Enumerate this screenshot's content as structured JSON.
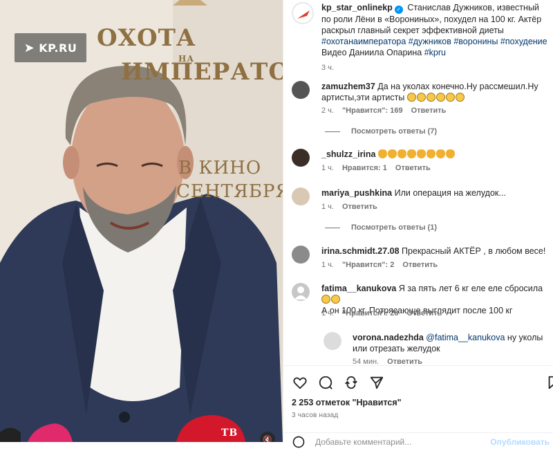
{
  "media": {
    "watermark": "KP.RU",
    "poster_title_line1": "ОХОТА",
    "poster_title_small": "НА",
    "poster_title_line2": "ИМПЕРАТОРА",
    "poster_sub1": "В КИНО",
    "poster_sub2": "СЕНТЯБРЯ",
    "mic_brand": "ТВ"
  },
  "post": {
    "username": "kp_star_onlinekp",
    "caption_text": "Станислав Дужников, известный по роли Лёни в «Ворониных», похудел на 100 кг. Актёр раскрыл главный секрет эффективной диеты",
    "tags1": "#охотанаимператора",
    "tags2": "#дужников #воронины #похудение",
    "video_credit": "Видео Даниила Опарина",
    "tag_kpru": "#kpru",
    "time": "3 ч."
  },
  "comments": [
    {
      "username": "zamuzhem37",
      "text": "Да на уколах конечно.Ну рассмешил.Ну артисты,эти артисты",
      "time": "2 ч.",
      "likes": "\"Нравится\": 169",
      "reply": "Ответить",
      "view_replies": "Посмотреть ответы (7)"
    },
    {
      "username": "_shulzz_irina",
      "text": "",
      "time": "1 ч.",
      "likes": "Нравится: 1",
      "reply": "Ответить"
    },
    {
      "username": "mariya_pushkina",
      "text": "Или операция на желудок...",
      "time": "1 ч.",
      "reply": "Ответить",
      "view_replies": "Посмотреть ответы (1)"
    },
    {
      "username": "irina.schmidt.27.08",
      "text": "Прекрасный АКТЁР , в любом весе!",
      "time": "1 ч.",
      "likes": "\"Нравится\": 2",
      "reply": "Ответить"
    },
    {
      "username": "fatima__kanukova",
      "text": "Я за пять лет 6 кг еле еле сбросила",
      "text2": "А он 100 кг. Потрясающе выглядит после 100 кг",
      "time": "1 ч.",
      "likes": "\"Нравится\": 28",
      "reply": "Ответить"
    },
    {
      "username": "vorona.nadezhda",
      "mention": "@fatima__kanukova",
      "text": "ну уколы или отрезать желудок",
      "time": "54 мин.",
      "reply": "Ответить"
    }
  ],
  "footer": {
    "likes": "2 253 отметок \"Нравится\"",
    "ago": "3 часов назад",
    "add_comment_placeholder": "Добавьте комментарий...",
    "publish": "Опубликовать"
  },
  "colors": {
    "link": "#00376b",
    "muted": "#737373",
    "verified": "#0095f6"
  }
}
